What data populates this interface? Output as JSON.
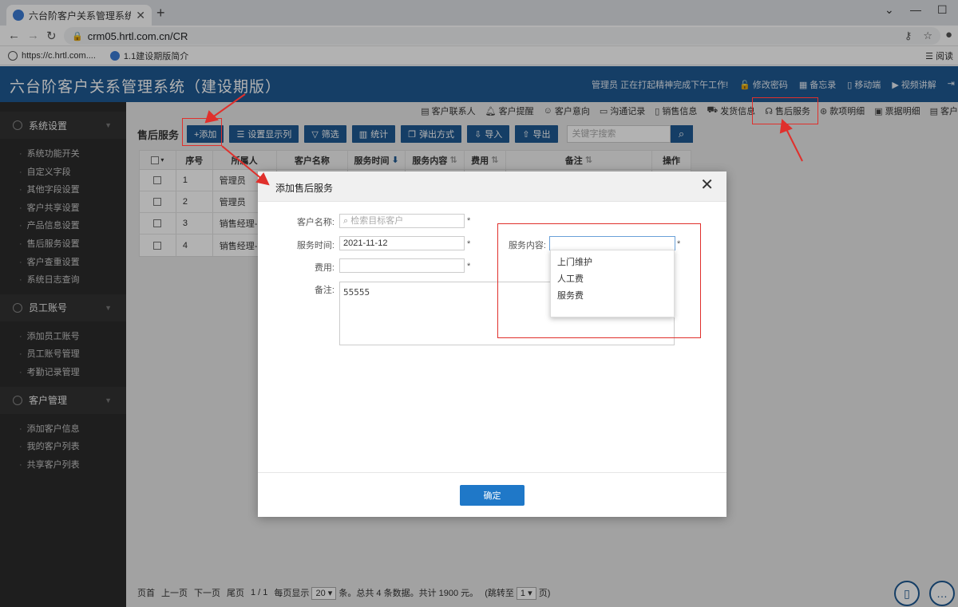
{
  "browser": {
    "tab_title": "六台阶客户关系管理系统（建设期",
    "url": "crm05.hrtl.com.cn/CR",
    "bookmarks": [
      "https://c.hrtl.com....",
      "1.1建设期版简介"
    ],
    "reading_label": "阅读"
  },
  "app": {
    "title": "六台阶客户关系管理系统（建设期版）",
    "header_status": "管理员 正在打起精神完成下午工作!",
    "header_links": [
      "修改密码",
      "备忘录",
      "移动端",
      "视频讲解"
    ]
  },
  "sidebar": {
    "sections": [
      {
        "title": "系统设置",
        "items": [
          "系统功能开关",
          "自定义字段",
          "其他字段设置",
          "客户共享设置",
          "产品信息设置",
          "售后服务设置",
          "客户查重设置",
          "系统日志查询"
        ]
      },
      {
        "title": "员工账号",
        "items": [
          "添加员工账号",
          "员工账号管理",
          "考勤记录管理"
        ]
      },
      {
        "title": "客户管理",
        "items": [
          "添加客户信息",
          "我的客户列表",
          "共享客户列表"
        ]
      }
    ]
  },
  "subnav": [
    "客户联系人",
    "客户提醒",
    "客户意向",
    "沟通记录",
    "销售信息",
    "发货信息",
    "售后服务",
    "款项明细",
    "票据明细",
    "客户"
  ],
  "page": {
    "title": "售后服务",
    "toolbar": [
      "+添加",
      "设置显示列",
      "筛选",
      "统计",
      "弹出方式",
      "导入",
      "导出"
    ],
    "search_placeholder": "关键字搜索"
  },
  "table": {
    "headers": [
      "",
      "序号",
      "所属人",
      "客户名称",
      "服务时间",
      "服务内容",
      "费用",
      "备注",
      "操作"
    ],
    "rows": [
      [
        "1",
        "管理员"
      ],
      [
        "2",
        "管理员"
      ],
      [
        "3",
        "销售经理-刘"
      ],
      [
        "4",
        "销售经理-刘"
      ]
    ]
  },
  "pager": {
    "first": "页首",
    "prev": "上一页",
    "next": "下一页",
    "last": "尾页",
    "page_info": "1 / 1",
    "per_page_label": "每页显示",
    "per_page": "20",
    "summary": "条。总共 4 条数据。共计 1900 元。",
    "jump_label": "(跳转至",
    "jump_value": "1",
    "jump_suffix": "页)"
  },
  "modal": {
    "title": "添加售后服务",
    "customer_label": "客户名称:",
    "customer_placeholder": "检索目标客户",
    "time_label": "服务时间:",
    "time_value": "2021-11-12",
    "content_label": "服务内容:",
    "fee_label": "费用:",
    "note_label": "备注:",
    "note_value": "55555",
    "required_mark": "*",
    "content_options": [
      "上门维护",
      "人工费",
      "服务费"
    ],
    "ok_label": "确定"
  },
  "colors": {
    "header": "#1f5a93",
    "sidebar": "#2b2b2b",
    "primary_button": "#1f78c8",
    "annotation": "#e0302c"
  }
}
